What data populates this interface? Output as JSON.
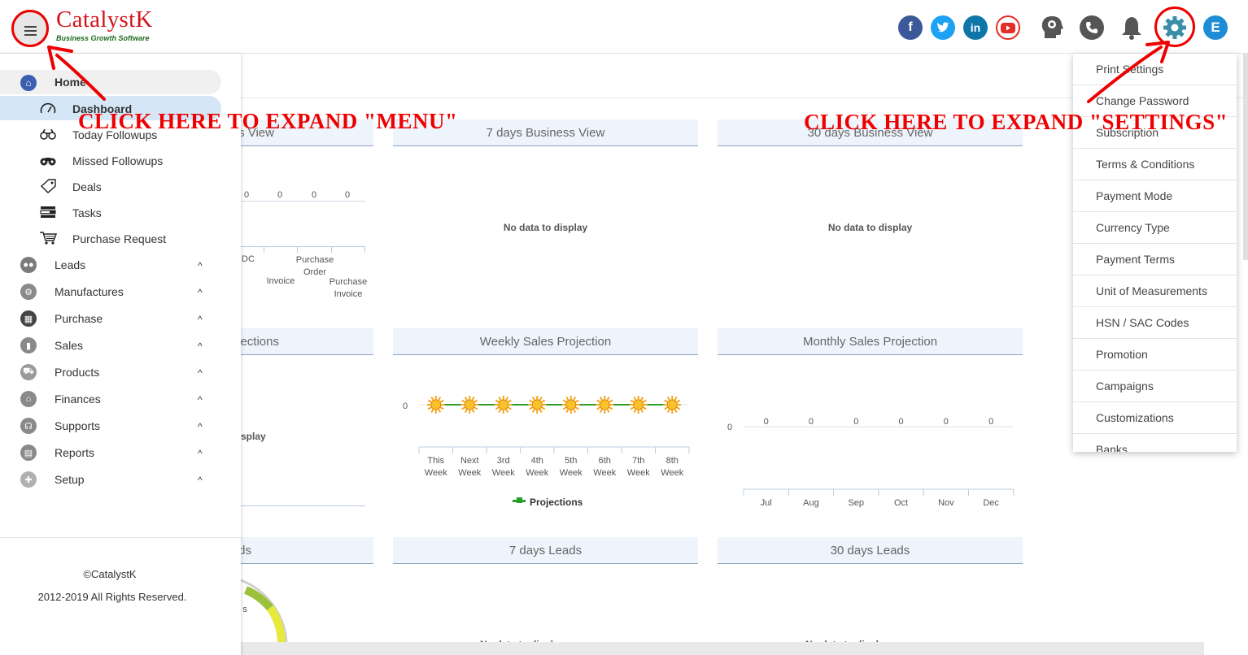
{
  "brand": {
    "name": "CatalystK",
    "tagline": "Business Growth Software"
  },
  "header": {
    "avatar_letter": "E"
  },
  "sidebar": {
    "home_label": "Home",
    "sub_items": [
      {
        "label": "Dashboard",
        "icon": "speedometer-icon"
      },
      {
        "label": "Today Followups",
        "icon": "binoculars-icon"
      },
      {
        "label": "Missed Followups",
        "icon": "binoculars-icon"
      },
      {
        "label": "Deals",
        "icon": "tag-icon"
      },
      {
        "label": "Tasks",
        "icon": "tasks-icon"
      },
      {
        "label": "Purchase Request",
        "icon": "cart-icon"
      }
    ],
    "groups": [
      {
        "label": "Leads",
        "icon": "people-icon"
      },
      {
        "label": "Manufactures",
        "icon": "factory-icon"
      },
      {
        "label": "Purchase",
        "icon": "cash-register-icon"
      },
      {
        "label": "Sales",
        "icon": "bar-chart-icon"
      },
      {
        "label": "Products",
        "icon": "cart-icon"
      },
      {
        "label": "Finances",
        "icon": "bank-icon"
      },
      {
        "label": "Supports",
        "icon": "headset-icon"
      },
      {
        "label": "Reports",
        "icon": "report-icon"
      },
      {
        "label": "Setup",
        "icon": "setup-icon"
      }
    ],
    "caret": "^",
    "copyright": "©CatalystK",
    "rights": "2012-2019 All Rights Reserved."
  },
  "settings_menu": {
    "items": [
      "Print Settings",
      "Change Password",
      "Subscription",
      "Terms & Conditions",
      "Payment Mode",
      "Currency Type",
      "Payment Terms",
      "Unit of Measurements",
      "HSN / SAC Codes",
      "Promotion",
      "Campaigns",
      "Customizations",
      "Banks"
    ]
  },
  "annotations": {
    "menu": "CLICK HERE TO EXPAND \"MENU\"",
    "settings": "CLICK HERE TO EXPAND \"SETTINGS\"",
    "color": "#e00000"
  },
  "panels": {
    "p1_title_partial": "s View",
    "p1_values": [
      "0",
      "0",
      "0",
      "0"
    ],
    "p1_cats": [
      "DC",
      "Invoice",
      "Purchase Order",
      "Purchase Invoice"
    ],
    "p2_title": "7 days Business View",
    "p3_title": "30 days Business View",
    "no_data": "No data to display",
    "p4_title_partial": "ections",
    "p4_nodata_partial": "splay",
    "p5_title": "Weekly Sales Projection",
    "p6_title": "Monthly Sales Projection",
    "p7_title_partial": "ds",
    "p8_title": "7 days Leads",
    "p9_title": "30 days Leads",
    "p10_gauge_partial": "s"
  },
  "chart_data": [
    {
      "type": "line",
      "title": "Weekly Sales Projection",
      "categories": [
        "This Week",
        "Next Week",
        "3rd Week",
        "4th Week",
        "5th Week",
        "6th Week",
        "7th Week",
        "8th Week"
      ],
      "series": [
        {
          "name": "Projections",
          "values": [
            0,
            0,
            0,
            0,
            0,
            0,
            0,
            0
          ],
          "color": "#2a9d2a"
        }
      ],
      "y_tick": "0"
    },
    {
      "type": "bar",
      "title": "Monthly Sales Projection",
      "categories": [
        "Jul",
        "Aug",
        "Sep",
        "Oct",
        "Nov",
        "Dec"
      ],
      "values": [
        0,
        0,
        0,
        0,
        0,
        0
      ],
      "y_tick": "0"
    }
  ]
}
